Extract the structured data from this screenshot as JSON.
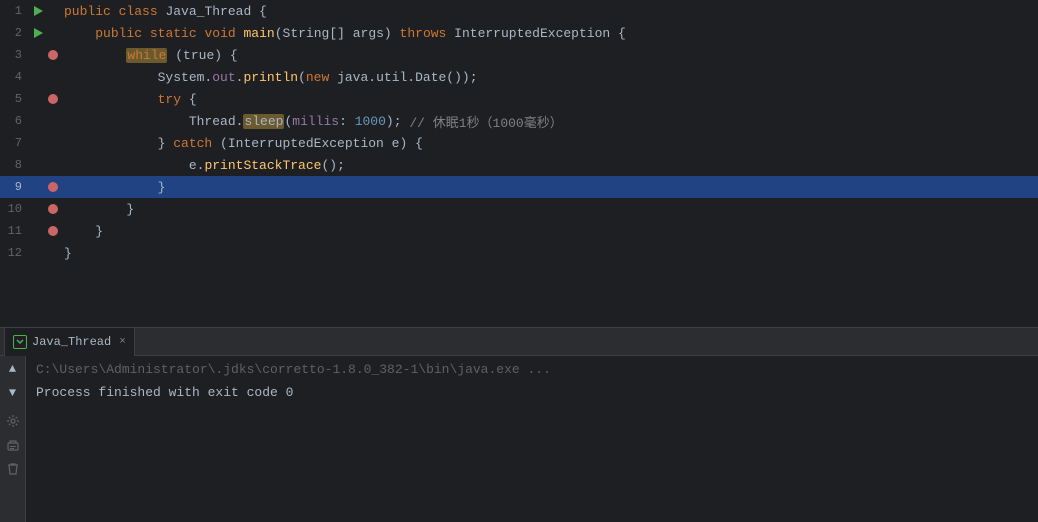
{
  "editor": {
    "lines": [
      {
        "num": 1,
        "hasRun": true,
        "hasBreakpoint": false,
        "indent": 0
      },
      {
        "num": 2,
        "hasRun": true,
        "hasBreakpoint": false,
        "indent": 1
      },
      {
        "num": 3,
        "hasRun": false,
        "hasBreakpoint": true,
        "indent": 2
      },
      {
        "num": 4,
        "hasRun": false,
        "hasBreakpoint": false,
        "indent": 3
      },
      {
        "num": 5,
        "hasRun": false,
        "hasBreakpoint": true,
        "indent": 3
      },
      {
        "num": 6,
        "hasRun": false,
        "hasBreakpoint": false,
        "indent": 4
      },
      {
        "num": 7,
        "hasRun": false,
        "hasBreakpoint": false,
        "indent": 3
      },
      {
        "num": 8,
        "hasRun": false,
        "hasBreakpoint": false,
        "indent": 4
      },
      {
        "num": 9,
        "hasRun": false,
        "hasBreakpoint": true,
        "indent": 3,
        "highlighted": true
      },
      {
        "num": 10,
        "hasRun": false,
        "hasBreakpoint": true,
        "indent": 2
      },
      {
        "num": 11,
        "hasRun": false,
        "hasBreakpoint": true,
        "indent": 1
      },
      {
        "num": 12,
        "hasRun": false,
        "hasBreakpoint": false,
        "indent": 0
      }
    ],
    "filename": "Java_Thread.java"
  },
  "console": {
    "tab_label": "Java_Thread",
    "tab_close": "×",
    "cmd_line": "C:\\Users\\Administrator\\.jdks\\corretto-1.8.0_382-1\\bin\\java.exe ...",
    "output_line": "Process finished with exit code 0"
  },
  "sidebar_buttons": [
    {
      "name": "scroll-up",
      "symbol": "▲"
    },
    {
      "name": "scroll-down",
      "symbol": "▼"
    },
    {
      "name": "settings",
      "symbol": "⚙"
    },
    {
      "name": "print",
      "symbol": "⎙"
    },
    {
      "name": "delete",
      "symbol": "🗑"
    }
  ]
}
